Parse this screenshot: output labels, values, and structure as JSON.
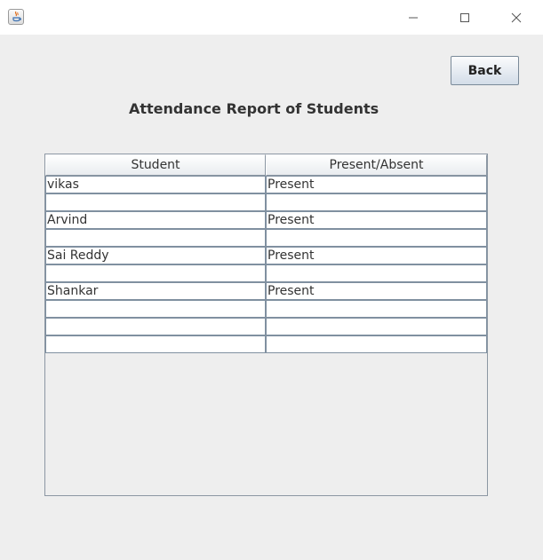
{
  "window": {
    "controls": {
      "minimize": "minimize-icon",
      "maximize": "maximize-icon",
      "close": "close-icon"
    }
  },
  "toolbar": {
    "back_label": "Back"
  },
  "page": {
    "title": "Attendance Report of Students"
  },
  "table": {
    "headers": [
      "Student",
      "Present/Absent"
    ],
    "rows": [
      [
        "vikas",
        "Present"
      ],
      [
        "",
        ""
      ],
      [
        "Arvind",
        "Present"
      ],
      [
        "",
        ""
      ],
      [
        "Sai Reddy",
        "Present"
      ],
      [
        "",
        ""
      ],
      [
        "Shankar",
        "Present"
      ],
      [
        "",
        ""
      ],
      [
        "",
        ""
      ],
      [
        "",
        ""
      ]
    ]
  },
  "colors": {
    "window_bg": "#eeeeee",
    "grid_line": "#8090a0",
    "button_gradient_end": "#d3dde8"
  }
}
